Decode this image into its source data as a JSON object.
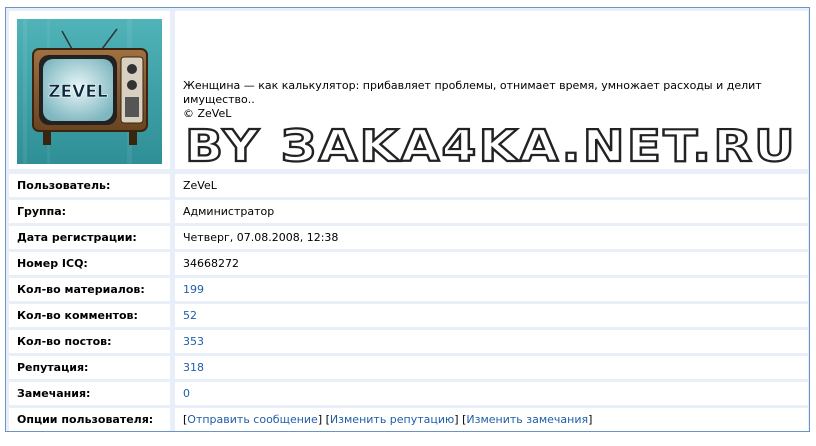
{
  "profile": {
    "signature": {
      "quote": "Женщина — как калькулятор: прибавляет проблемы, отнимает время, умножает расходы и делит имущество..",
      "author": "© ZeVeL",
      "banner_text": "BY ЗAKA4KA.NET.RU"
    },
    "avatar": {
      "logo_text": "ZEVEL"
    },
    "rows": [
      {
        "label": "Пользователь:",
        "value": "ZeVeL"
      },
      {
        "label": "Группа:",
        "value": "Администратор"
      },
      {
        "label": "Дата регистрации:",
        "value": "Четверг, 07.08.2008, 12:38"
      },
      {
        "label": "Номер ICQ:",
        "value": "34668272"
      },
      {
        "label": "Кол-во материалов:",
        "value": "199"
      },
      {
        "label": "Кол-во комментов:",
        "value": "52"
      },
      {
        "label": "Кол-во постов:",
        "value": "353"
      },
      {
        "label": "Репутация:",
        "value": "318"
      },
      {
        "label": "Замечания:",
        "value": "0"
      },
      {
        "label": "Опции пользователя:",
        "value": ""
      }
    ],
    "options": {
      "send_message": "Отправить сообщение",
      "change_reputation": "Изменить репутацию",
      "change_warnings": "Изменить замечания"
    }
  },
  "colors": {
    "border": "#6b93c4",
    "link": "#1f5ea8",
    "background": "#e9eff8"
  }
}
